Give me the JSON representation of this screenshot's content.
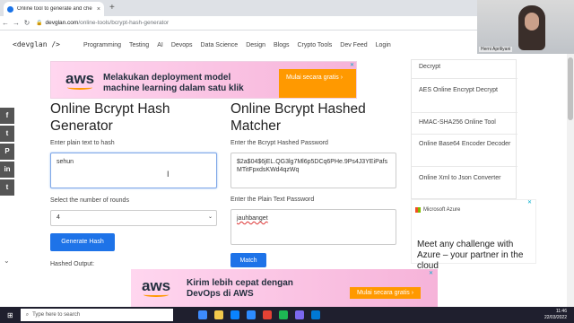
{
  "browser": {
    "tab_title": "Online tool to generate and che",
    "tab_close": "×",
    "new_tab": "+",
    "url_host": "devglan.com",
    "url_path": "/online-tools/bcrypt-hash-generator"
  },
  "site": {
    "logo": "<devglan />",
    "nav": [
      "Programming",
      "Testing",
      "AI",
      "Devops",
      "Data Science",
      "Design",
      "Blogs",
      "Crypto Tools",
      "Dev Feed",
      "Login"
    ]
  },
  "ad_top": {
    "brand": "aws",
    "line1": "Melakukan deployment model",
    "line2": "machine learning dalam satu klik",
    "cta": "Mulai secara gratis ›",
    "close": "✕"
  },
  "generator": {
    "title": "Online Bcrypt Hash Generator",
    "input_label": "Enter plain text to hash",
    "input_value": "sehun",
    "rounds_label": "Select the number of rounds",
    "rounds_value": "4",
    "button": "Generate Hash",
    "output_label": "Hashed Output:"
  },
  "matcher": {
    "title": "Online Bcrypt Hashed Matcher",
    "hash_label": "Enter the Bcrypt Hashed Password",
    "hash_value": "$2a$04$6jEL.QG3lg7Ml6p5DCq6PHe.9Ps4J3YEiPafsMTitFpxdsKWd4qzWq",
    "plain_label": "Enter the Plain Text Password",
    "plain_value": "jauhbanget",
    "button": "Match"
  },
  "sidebar": {
    "items": [
      "Decrypt",
      "AES Online Encrypt Decrypt",
      "HMAC-SHA256 Online Tool",
      "Online Base64 Encoder Decoder",
      "Online Xml to Json Converter"
    ]
  },
  "ad_side": {
    "brand": "Microsoft Azure",
    "text": "Meet any challenge with Azure – your partner in the cloud"
  },
  "ad_bottom": {
    "brand": "aws",
    "line1": "Kirim lebih cepat dengan",
    "line2": "DevOps di AWS",
    "cta": "Mulai secara gratis ›",
    "close": "✕"
  },
  "share_icons": [
    "f",
    "t",
    "P",
    "in",
    "t"
  ],
  "webcam": {
    "name": "Herni Apriliyani"
  },
  "taskbar": {
    "search_placeholder": "Type here to search",
    "time": "11:46",
    "date": "22/03/2022"
  }
}
